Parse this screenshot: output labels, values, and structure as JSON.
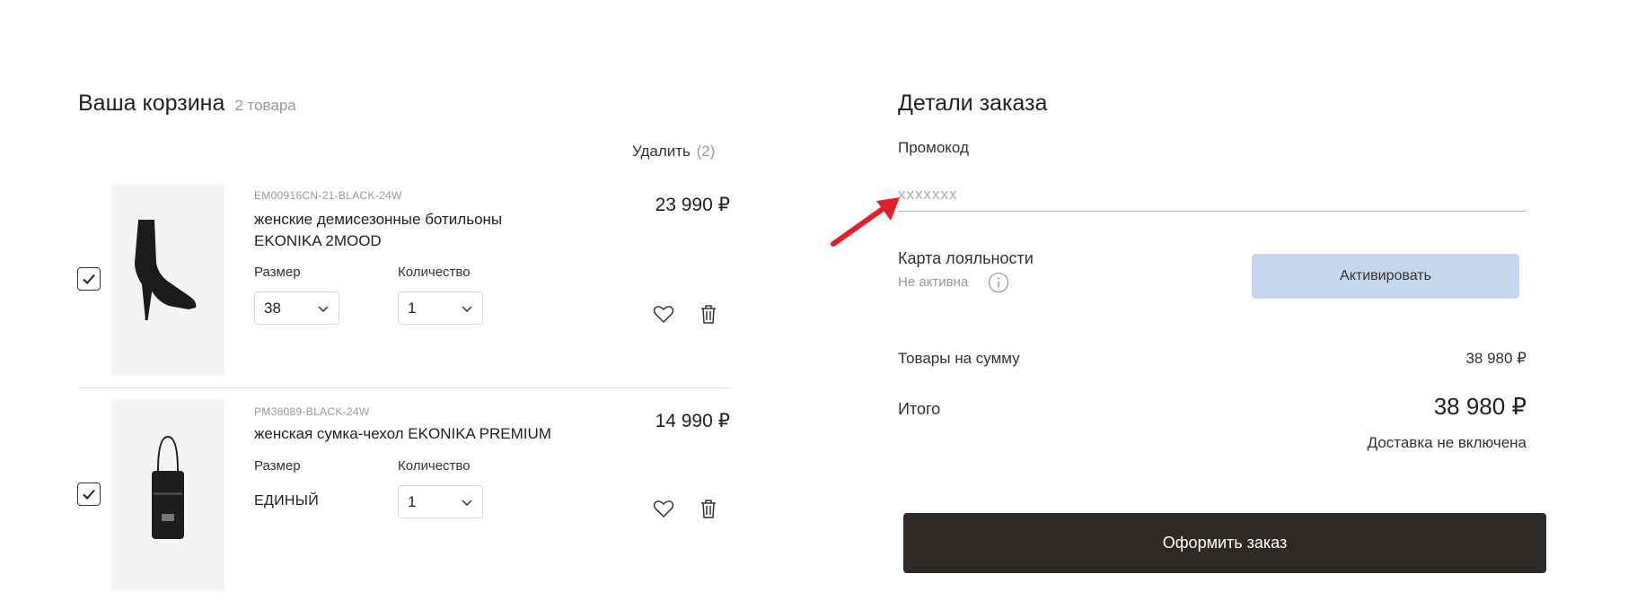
{
  "cart": {
    "title": "Ваша корзина",
    "count_label": "2 товара",
    "delete_label": "Удалить",
    "delete_count": "(2)",
    "items": [
      {
        "sku": "EM00916CN-21-BLACK-24W",
        "name": "женские демисезонные ботильоны EKONIKA 2MOOD",
        "size_label": "Размер",
        "size_value": "38",
        "quantity_label": "Количество",
        "quantity_value": "1",
        "price": "23 990 ₽",
        "checked": true
      },
      {
        "sku": "PM38089-BLACK-24W",
        "name": "женская сумка-чехол EKONIKA PREMIUM",
        "size_label": "Размер",
        "size_value": "ЕДИНЫЙ",
        "quantity_label": "Количество",
        "quantity_value": "1",
        "price": "14 990 ₽",
        "checked": true
      }
    ]
  },
  "order": {
    "title": "Детали заказа",
    "promo_label": "Промокод",
    "promo_placeholder": "xxxxxxx",
    "loyalty_label": "Карта лояльности",
    "loyalty_status": "Не активна",
    "activate_label": "Активировать",
    "subtotal_label": "Товары на сумму",
    "subtotal_value": "38 980 ₽",
    "total_label": "Итого",
    "total_value": "38 980 ₽",
    "delivery_note": "Доставка не включена",
    "checkout_label": "Оформить заказ"
  },
  "colors": {
    "activate_bg": "#c5d7ec",
    "checkout_bg": "#2d2926",
    "annotation_arrow": "#e0212b"
  },
  "icons": {
    "checkbox": "check-icon",
    "dropdown": "chevron-down-icon",
    "favorite": "heart-icon",
    "remove": "trash-icon",
    "info": "info-icon"
  }
}
